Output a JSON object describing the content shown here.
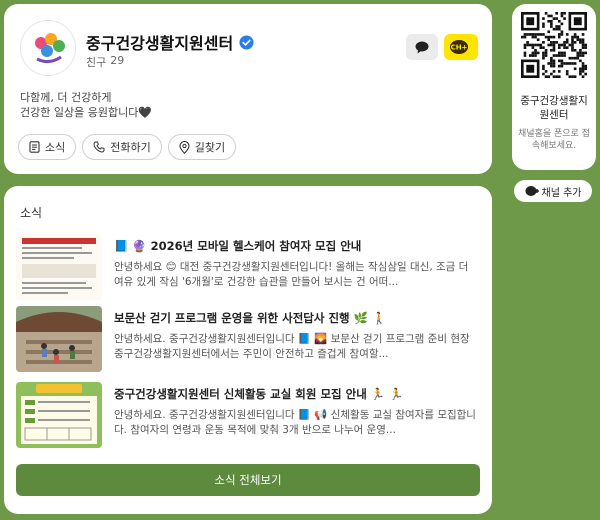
{
  "profile": {
    "name": "중구건강생활지원센터",
    "friends_label": "친구",
    "friends_count": "29",
    "intro_line1": "다함께, 더 건강하게",
    "intro_line2": "건강한 일상을 응원합니다🖤",
    "chplus_label": "CH+",
    "actions": {
      "news": "소식",
      "call": "전화하기",
      "directions": "길찾기"
    }
  },
  "news": {
    "heading": "소식",
    "items": [
      {
        "title": "📘 🔮 2026년 모바일 헬스케어 참여자 모집 안내",
        "body": "안녕하세요 😊 대전 중구건강생활지원센터입니다! 올해는 작심삼일 대신, 조금 더 여유 있게 작심 '6개월'로 건강한 습관을 만들어 보시는 건 어떠..."
      },
      {
        "title": "보문산 걷기 프로그램 운영을 위한 사전답사 진행 🌿 🚶",
        "body": "안녕하세요. 중구건강생활지원센터입니다 📘 🌄 보문산 걷기 프로그램 준비 현장 중구건강생활지원센터에서는 주민이 안전하고 즐겁게 참여할..."
      },
      {
        "title": "중구건강생활지원센터 신체활동 교실 회원 모집 안내 🏃 🏃",
        "body": "안녕하세요. 중구건강생활지원센터입니다 📘 📢 신체활동 교실 참여자를 모집합니다. 참여자의 연령과 운동 목적에 맞춰 3개 반으로 나누어 운영..."
      }
    ],
    "view_all": "소식 전체보기"
  },
  "qr": {
    "name": "중구건강생활지원센터",
    "hint": "채널홈을 폰으로 접속해보세요."
  },
  "add_channel": "채널 추가",
  "colors": {
    "background": "#6e9948",
    "button_green": "#5e8a3e",
    "kakao_yellow": "#fee500",
    "verified_blue": "#2b7de9"
  }
}
